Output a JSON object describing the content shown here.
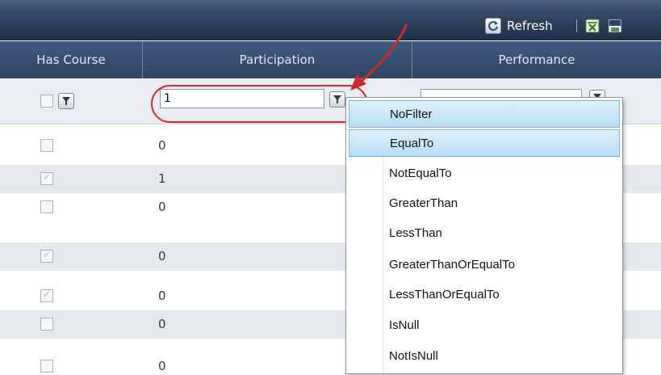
{
  "toolbar": {
    "refresh_label": "Refresh",
    "refresh_icon": "refresh-icon",
    "export_excel_icon": "excel-export-icon",
    "export_csv_icon": "csv-export-icon"
  },
  "grid": {
    "columns": [
      "Has Course",
      "Participation",
      "Performance"
    ],
    "filter": {
      "participation_value": "1",
      "performance_value": ""
    },
    "rows": [
      {
        "has_course": false,
        "participation": "0"
      },
      {
        "has_course": true,
        "participation": "1"
      },
      {
        "has_course": false,
        "participation": "0"
      },
      {
        "has_course": true,
        "participation": "0"
      },
      {
        "has_course": true,
        "participation": "0"
      },
      {
        "has_course": false,
        "participation": "0"
      },
      {
        "has_course": false,
        "participation": "0"
      }
    ]
  },
  "filter_menu": {
    "items": [
      "NoFilter",
      "EqualTo",
      "NotEqualTo",
      "GreaterThan",
      "LessThan",
      "GreaterThanOrEqualTo",
      "LessThanOrEqualTo",
      "IsNull",
      "NotIsNull"
    ],
    "highlighted": [
      "NoFilter",
      "EqualTo"
    ]
  },
  "annotation": {
    "color": "#d22a2a"
  }
}
